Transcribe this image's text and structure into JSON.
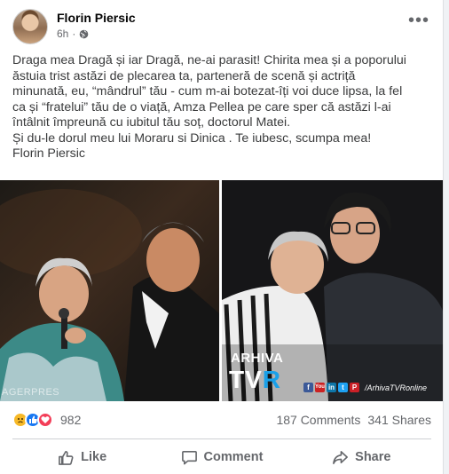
{
  "post": {
    "author": "Florin Piersic",
    "time": "6h",
    "privacy_separator": "·",
    "more_label": "•••",
    "text_lines": [
      "Draga mea Dragă și iar Dragă, ne-ai parasit!  Chirita mea și a poporului",
      "ăstuia trist astăzi de plecarea ta, parteneră de scenă și actriță",
      "minunată, eu, “mândrul” tău - cum m-ai botezat-îți voi duce lipsa, la fel",
      "ca și “fratelui” tău de o viață, Amza Pellea pe  care sper că astăzi l-ai",
      "întâlnit  împreună cu iubitul tău soț, doctorul Matei.",
      "Și du-le dorul meu lui Moraru si Dinica . Te iubesc, scumpa mea!",
      "Florin Piersic"
    ]
  },
  "photos": {
    "left_watermark": "AGERPRES",
    "right_arhiva": "ARHIVA",
    "right_tvr_prefix": "TV",
    "right_tvr_suffix": "R",
    "right_handle": "/ArhivaTVRonline",
    "social_icons": [
      "f",
      "You",
      "in",
      "t",
      "P"
    ]
  },
  "stats": {
    "reaction_count": "982",
    "comments": "187 Comments",
    "shares": "341 Shares"
  },
  "actions": {
    "like": "Like",
    "comment": "Comment",
    "share": "Share"
  },
  "colors": {
    "like_blue": "#1877f2",
    "love_red": "#f33e58",
    "sad_yellow": "#f7b928",
    "secondary_text": "#65676b"
  }
}
